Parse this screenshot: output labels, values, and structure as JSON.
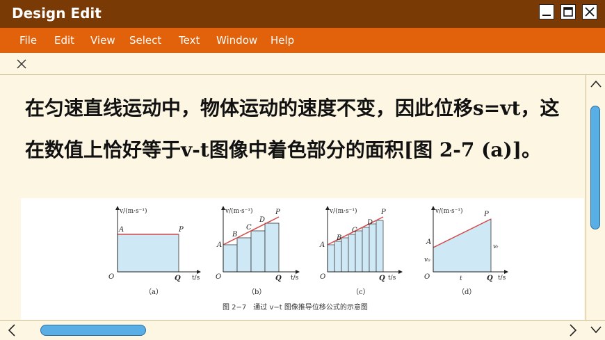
{
  "window": {
    "title": "Design Edit"
  },
  "menu": {
    "items": [
      "File",
      "Edit",
      "View",
      "Select",
      "Text",
      "Window",
      "Help"
    ]
  },
  "content": {
    "paragraph": "在匀速直线运动中，物体运动的速度不变，因此位移s=vt，这在数值上恰好等于v-t图像中着色部分的面积[图 2-7 (a)]。"
  },
  "figure": {
    "axis_v": "v/(m·s⁻¹)",
    "axis_t": "t/s",
    "origin": "O",
    "point_a": "A",
    "point_b": "B",
    "point_c": "C",
    "point_d": "D",
    "point_p": "P",
    "point_q": "Q",
    "label_v0": "v₀",
    "label_vt": "vₜ",
    "label_t": "t",
    "subs": [
      "（a）",
      "（b）",
      "（c）",
      "（d）"
    ],
    "caption": "图 2−7　通过 v−t 图像推导位移公式的示意图"
  },
  "colors": {
    "titlebar": "#7a3a06",
    "menubar": "#e2620c",
    "background": "#fdf6e3",
    "scroll_thumb": "#5aaee6",
    "fill": "#cfe8f5",
    "line": "#d24a4a"
  }
}
